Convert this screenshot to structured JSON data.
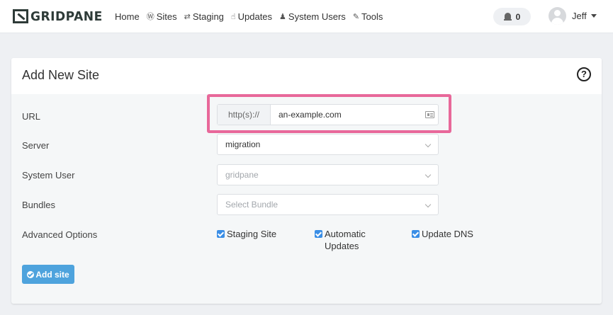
{
  "brand": {
    "name": "GRIDPANE"
  },
  "nav": {
    "items": [
      {
        "label": "Home",
        "icon": ""
      },
      {
        "label": "Sites",
        "icon": "wordpress-icon"
      },
      {
        "label": "Staging",
        "icon": "sync-icon"
      },
      {
        "label": "Updates",
        "icon": "thumbs-up-icon"
      },
      {
        "label": "System Users",
        "icon": "user-group-icon"
      },
      {
        "label": "Tools",
        "icon": "wrench-icon"
      }
    ],
    "notifications": {
      "count": "0",
      "icon": "bell-icon"
    },
    "user": {
      "name": "Jeff"
    }
  },
  "form": {
    "title": "Add New Site",
    "url": {
      "label": "URL",
      "prefix": "http(s)://",
      "value": "an-example.com"
    },
    "server": {
      "label": "Server",
      "value": "migration"
    },
    "system_user": {
      "label": "System User",
      "placeholder": "gridpane"
    },
    "bundles": {
      "label": "Bundles",
      "placeholder": "Select Bundle"
    },
    "advanced": {
      "label": "Advanced Options",
      "options": [
        {
          "label": "Staging Site",
          "checked": true
        },
        {
          "label": "Automatic Updates",
          "checked": true
        },
        {
          "label": "Update DNS",
          "checked": true
        }
      ]
    },
    "submit_label": "Add site"
  },
  "colors": {
    "accent": "#4ea3dd",
    "highlight": "#e8689a",
    "checkbox": "#3a8ee6"
  }
}
